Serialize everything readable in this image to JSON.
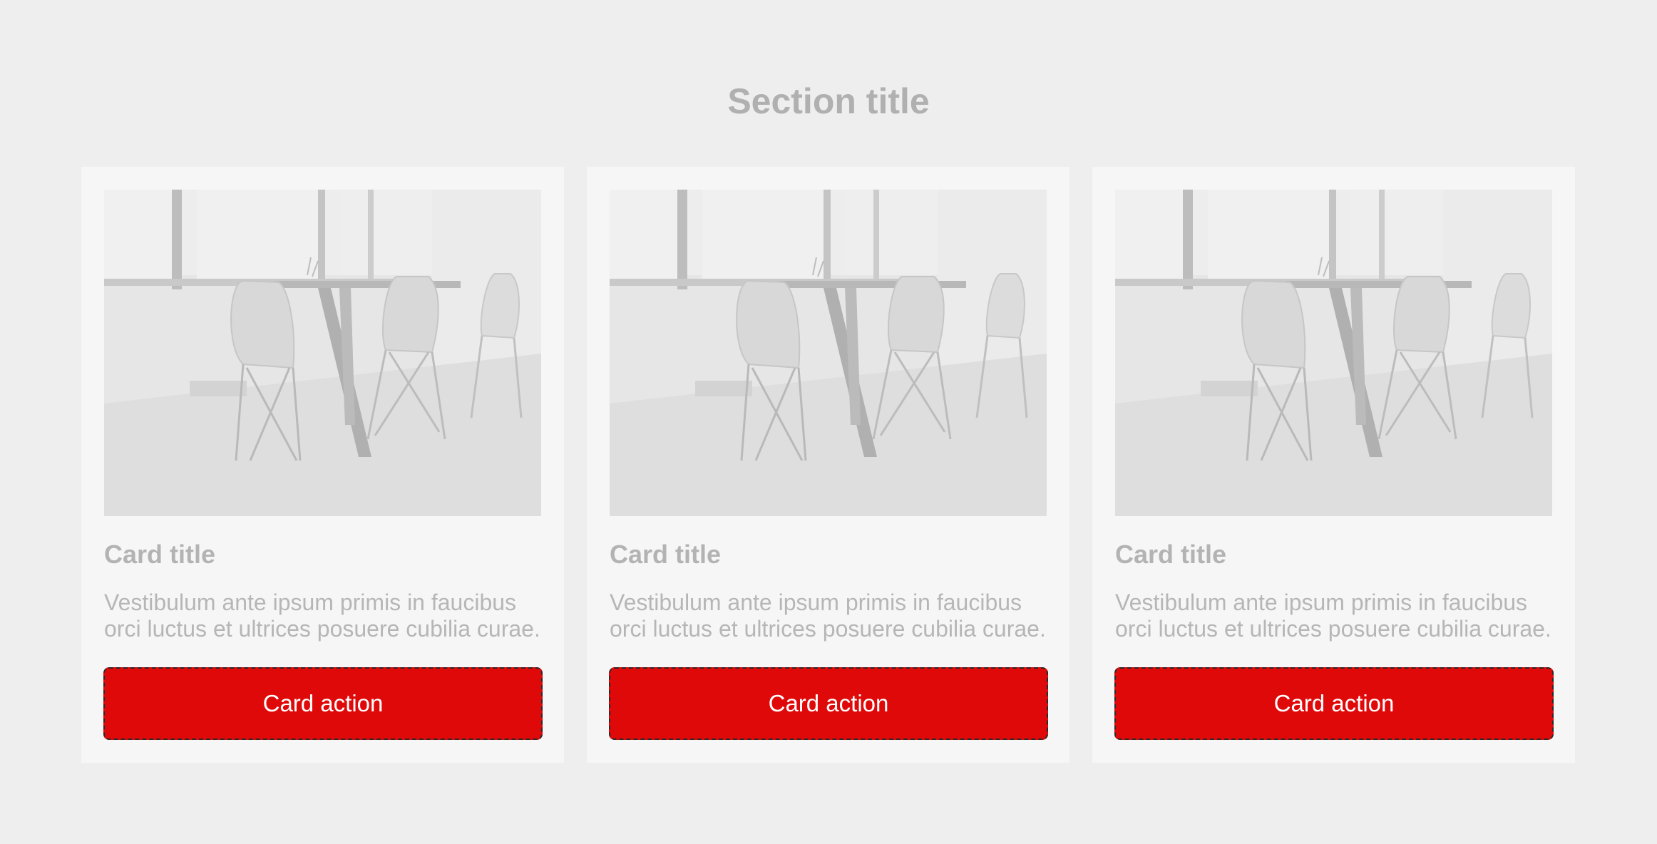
{
  "section": {
    "title": "Section title"
  },
  "cards": [
    {
      "title": "Card title",
      "text": "Vestibulum ante ipsum primis in faucibus orci luctus et ultrices posuere cubilia curae.",
      "action_label": "Card action"
    },
    {
      "title": "Card title",
      "text": "Vestibulum ante ipsum primis in faucibus orci luctus et ultrices posuere cubilia curae.",
      "action_label": "Card action"
    },
    {
      "title": "Card title",
      "text": "Vestibulum ante ipsum primis in faucibus orci luctus et ultrices posuere cubilia curae.",
      "action_label": "Card action"
    }
  ],
  "colors": {
    "page_background": "#eeeeee",
    "card_background": "#f6f6f6",
    "action_button": "#e00909",
    "muted_text": "#b0b0b0"
  },
  "image": {
    "subject": "dining-room-photo"
  }
}
